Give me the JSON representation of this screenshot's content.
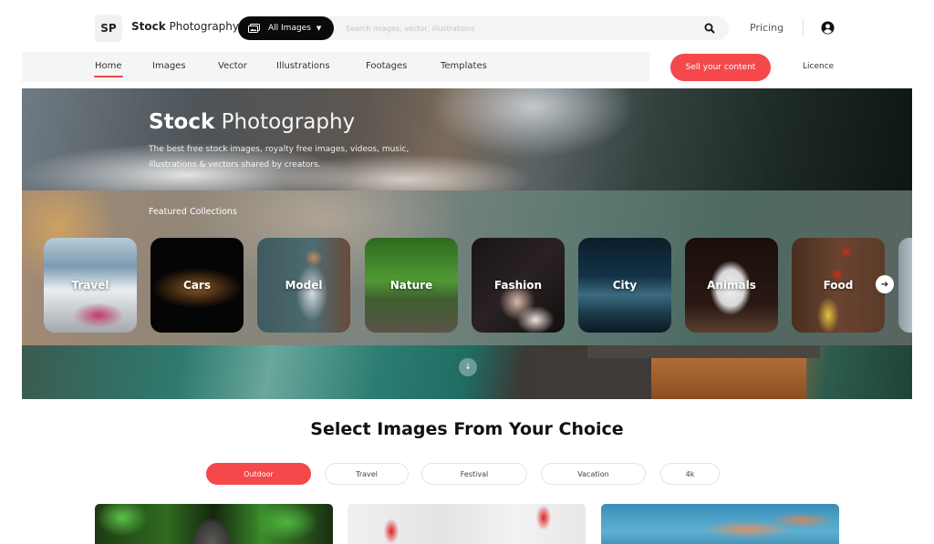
{
  "header": {
    "logo_initials": "SP",
    "brand_bold": "Stock",
    "brand_light": "Photography",
    "category_select": {
      "icon": "images-icon",
      "selected": "All Images"
    },
    "search": {
      "placeholder": "Search images, vector, illustrations",
      "value": ""
    },
    "pricing_label": "Pricing",
    "user_icon": "user-circle-icon"
  },
  "nav": {
    "items": [
      {
        "label": "Home",
        "active": true
      },
      {
        "label": "Images",
        "active": false
      },
      {
        "label": "Vector",
        "active": false
      },
      {
        "label": "Illustrations",
        "active": false
      },
      {
        "label": "Footages",
        "active": false
      },
      {
        "label": "Templates",
        "active": false
      }
    ],
    "sell_button": "Sell your content",
    "licence_label": "Licence"
  },
  "hero": {
    "title_bold": "Stock",
    "title_light": "Photography",
    "subtitle": "The best free stock images, royalty free images, videos, music, illustrations & vectors shared by creators.",
    "featured_label": "Featured Collections",
    "collections": [
      {
        "label": "Travel"
      },
      {
        "label": "Cars"
      },
      {
        "label": "Model"
      },
      {
        "label": "Nature"
      },
      {
        "label": "Fashion"
      },
      {
        "label": "City"
      },
      {
        "label": "Animals"
      },
      {
        "label": "Food"
      }
    ],
    "next_icon": "arrow-right-icon",
    "scroll_icon": "arrow-down-icon"
  },
  "section": {
    "title": "Select Images From Your Choice",
    "filters": [
      {
        "label": "Outdoor",
        "active": true
      },
      {
        "label": "Travel",
        "active": false
      },
      {
        "label": "Festival",
        "active": false
      },
      {
        "label": "Vacation",
        "active": false
      },
      {
        "label": "4k",
        "active": false
      }
    ]
  },
  "colors": {
    "accent": "#f5484b",
    "dark": "#0a0a0a",
    "nav_bg": "#f5f5f5"
  }
}
